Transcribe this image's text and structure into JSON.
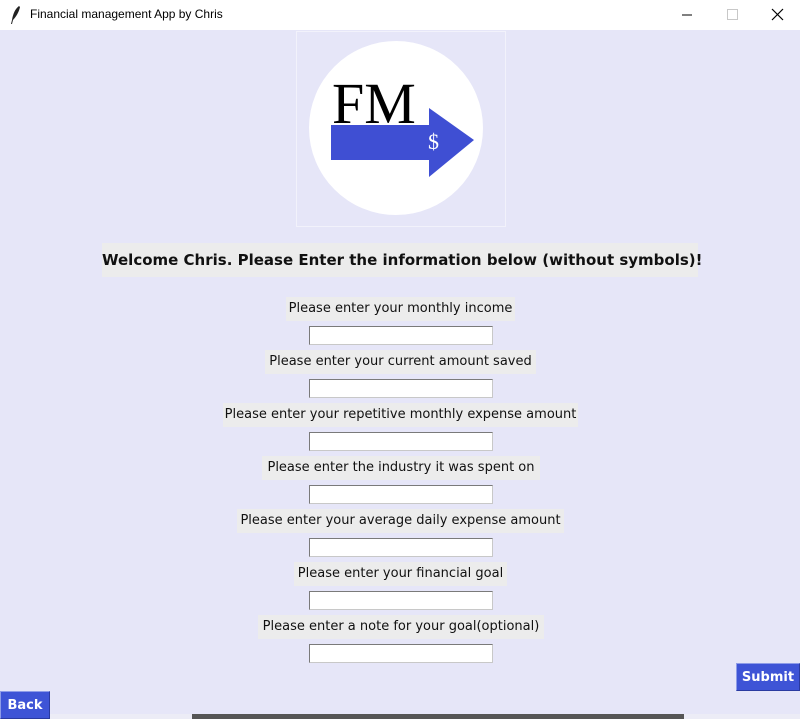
{
  "window": {
    "title": "Financial management App by Chris",
    "icons": {
      "app": "feather-icon",
      "minimize": "minimize-icon",
      "maximize": "maximize-icon",
      "close": "close-icon"
    }
  },
  "logo": {
    "letters": "FM",
    "symbol": "$",
    "accent": "#3f4fd3",
    "circle": "#ffffff"
  },
  "welcome": "Welcome Chris. Please Enter the information below (without symbols)!",
  "fields": [
    {
      "label": "Please enter your monthly income",
      "value": ""
    },
    {
      "label": "Please enter your current amount saved",
      "value": ""
    },
    {
      "label": "Please enter your repetitive monthly expense amount",
      "value": ""
    },
    {
      "label": "Please enter the industry it was spent on",
      "value": ""
    },
    {
      "label": "Please enter your average daily expense amount",
      "value": ""
    },
    {
      "label": "Please enter your financial goal",
      "value": ""
    },
    {
      "label": "Please enter a note for your goal(optional)",
      "value": ""
    }
  ],
  "buttons": {
    "submit": "Submit",
    "back": "Back"
  },
  "colors": {
    "background": "#e6e6f8",
    "button": "#3e54d6",
    "label_bg": "#ececec"
  }
}
